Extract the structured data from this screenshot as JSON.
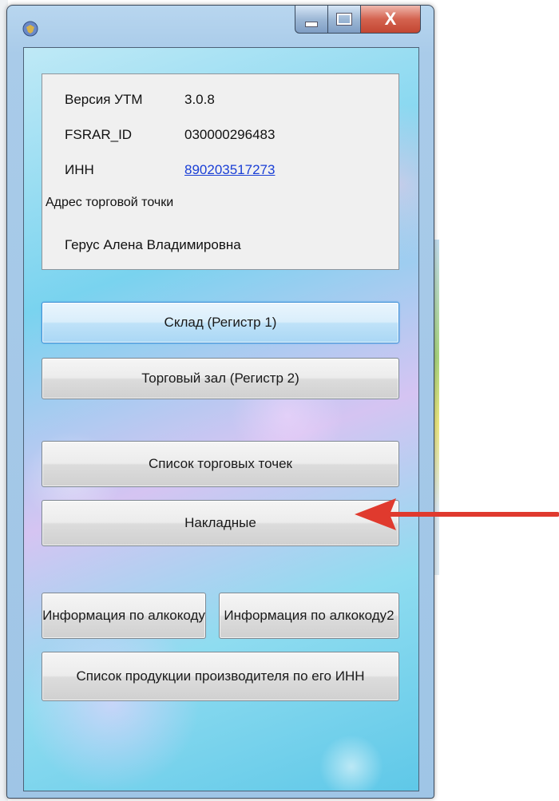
{
  "window": {
    "icon": "app-shield-icon",
    "buttons": [
      "minimize",
      "maximize",
      "close"
    ],
    "close_glyph": "X"
  },
  "info": {
    "version_label": "Версия УТМ",
    "version_value": "3.0.8",
    "fsrar_label": "FSRAR_ID",
    "fsrar_value": "030000296483",
    "inn_label": "ИНН",
    "inn_value": "890203517273",
    "address_label": "Адрес торговой точки",
    "owner_name": "Герус Алена Владимировна"
  },
  "buttons": {
    "warehouse": "Склад (Регистр 1)",
    "sales_floor": "Торговый зал (Регистр 2)",
    "outlets_list": "Список торговых точек",
    "invoices": "Накладные",
    "alcocode_info": "Информация по алкокоду",
    "alcocode_info2": "Информация по алкокоду2",
    "producer_products": "Список продукции производителя по его ИНН"
  },
  "annotation": {
    "type": "red-arrow-icon",
    "color": "#e03a2e",
    "points_to": "Накладные"
  },
  "colors": {
    "link": "#1a3fd6",
    "focus": "#3c8fd6"
  }
}
